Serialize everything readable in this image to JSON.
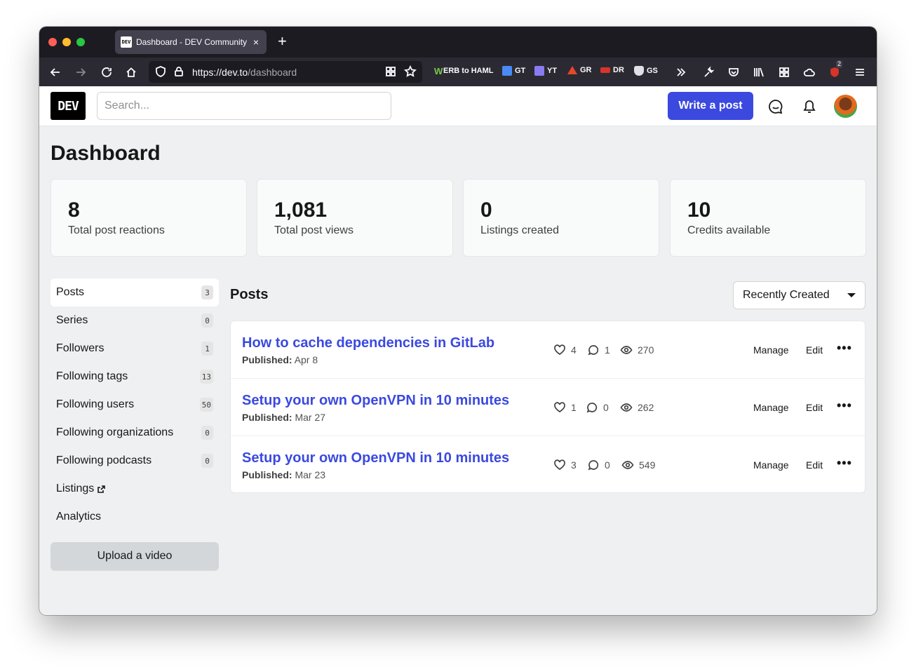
{
  "browser": {
    "tab_title": "Dashboard - DEV Community 📱",
    "tab_favicon_text": "DEV",
    "url_host": "https://dev.to",
    "url_path": "/dashboard",
    "bookmarks": [
      {
        "label": "ERB to HAML",
        "icon": "w-icon",
        "color": "#7cc84a"
      },
      {
        "label": "GT",
        "icon": "translate-icon",
        "color": "#4a8af4"
      },
      {
        "label": "YT",
        "icon": "youtube-icon",
        "color": "#8a7cf0"
      },
      {
        "label": "GR",
        "icon": "triangle-icon",
        "color": "#e8462c"
      },
      {
        "label": "DR",
        "icon": "dr-icon",
        "color": "#d9342b"
      },
      {
        "label": "GS",
        "icon": "shield-icon",
        "color": "#e0e0e6"
      }
    ],
    "extension_badge": "2"
  },
  "header": {
    "logo_text": "DEV",
    "search_placeholder": "Search...",
    "write_post_label": "Write a post"
  },
  "page": {
    "title": "Dashboard"
  },
  "stats": [
    {
      "value": "8",
      "label": "Total post reactions"
    },
    {
      "value": "1,081",
      "label": "Total post views"
    },
    {
      "value": "0",
      "label": "Listings created"
    },
    {
      "value": "10",
      "label": "Credits available"
    }
  ],
  "sidebar": {
    "items": [
      {
        "label": "Posts",
        "count": "3"
      },
      {
        "label": "Series",
        "count": "0"
      },
      {
        "label": "Followers",
        "count": "1"
      },
      {
        "label": "Following tags",
        "count": "13"
      },
      {
        "label": "Following users",
        "count": "50"
      },
      {
        "label": "Following organizations",
        "count": "0"
      },
      {
        "label": "Following podcasts",
        "count": "0"
      },
      {
        "label": "Listings"
      },
      {
        "label": "Analytics"
      }
    ],
    "upload_label": "Upload a video"
  },
  "posts": {
    "heading": "Posts",
    "sort_value": "Recently Created",
    "published_label": "Published:",
    "manage_label": "Manage",
    "edit_label": "Edit",
    "more_label": "•••",
    "items": [
      {
        "title": "How to cache dependencies in GitLab",
        "date": "Apr 8",
        "reactions": "4",
        "comments": "1",
        "views": "270"
      },
      {
        "title": "Setup your own OpenVPN in 10 minutes",
        "date": "Mar 27",
        "reactions": "1",
        "comments": "0",
        "views": "262"
      },
      {
        "title": "Setup your own OpenVPN in 10 minutes",
        "date": "Mar 23",
        "reactions": "3",
        "comments": "0",
        "views": "549"
      }
    ]
  }
}
